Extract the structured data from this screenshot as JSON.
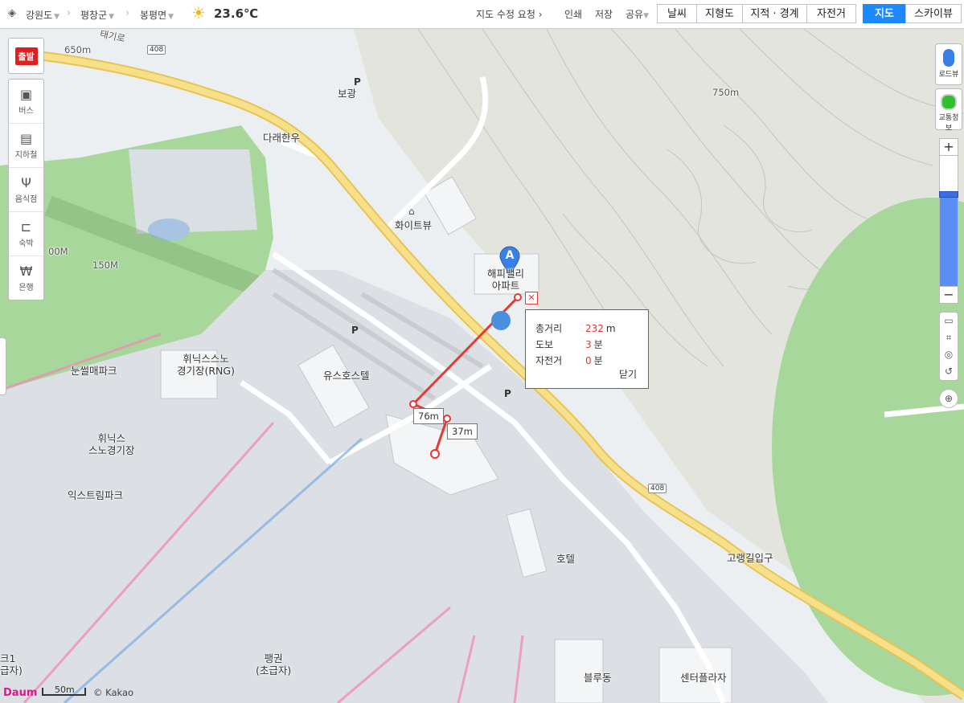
{
  "topbar": {
    "region1": "강원도",
    "region2": "평창군",
    "region3": "봉평면",
    "temperature": "23.6℃",
    "map_edit_request": "지도 수정 요청",
    "print": "인쇄",
    "save": "저장",
    "share": "공유",
    "overlays": [
      "날씨",
      "지형도",
      "지적 · 경계",
      "자전거"
    ],
    "map_types": [
      "지도",
      "스카이뷰"
    ],
    "active_map_type": "지도"
  },
  "left_toolbar": {
    "start_label": "출발",
    "categories": [
      {
        "label": "버스",
        "icon": "bus-icon"
      },
      {
        "label": "지하철",
        "icon": "subway-icon"
      },
      {
        "label": "음식점",
        "icon": "restaurant-icon"
      },
      {
        "label": "숙박",
        "icon": "bed-icon"
      },
      {
        "label": "은행",
        "icon": "bank-icon"
      }
    ]
  },
  "right_toolbar": {
    "roadview": "로드뷰",
    "traffic": "교통정보",
    "zoom_in": "+",
    "zoom_out": "−"
  },
  "map_labels": {
    "bogwang": "보광",
    "daraehanwoo": "다래한우",
    "whiteview": "화이트뷰",
    "apartment": "해피밸리\n아파트",
    "youth_hostel": "유스호스텔",
    "snow_park": "눈썰매파크",
    "rng": "휘닉스스노\n경기장(RNG)",
    "snow_stadium": "휘닉스\n스노경기장",
    "extreme_park": "익스트림파크",
    "hotel": "호텔",
    "goraengil": "고랭길입구",
    "pyeonggwon": "팽권\n(초급자)",
    "blue_dong": "블루동",
    "center_plaza": "센터플라자",
    "slope_left": "크1\n급자)",
    "contour_650": "650m",
    "contour_750": "750m",
    "contour_150": "150M",
    "contour_00": "00M",
    "road_408": "408",
    "road_name": "태기로",
    "parking": "P"
  },
  "measure": {
    "segment1": "76m",
    "segment2": "37m",
    "summary": {
      "total_label": "총거리",
      "total_value": "232",
      "total_unit": "m",
      "walk_label": "도보",
      "walk_value": "3",
      "walk_unit": "분",
      "bike_label": "자전거",
      "bike_value": "0",
      "bike_unit": "분",
      "close": "닫기"
    },
    "marker": "A"
  },
  "footer": {
    "logo": "Daum",
    "scale": "50m",
    "copyright": "© Kakao"
  },
  "colors": {
    "measure_line": "#e53935",
    "road_major": "#f5d56a",
    "green_area": "#a7d79a",
    "active_button": "#1e88ff"
  }
}
